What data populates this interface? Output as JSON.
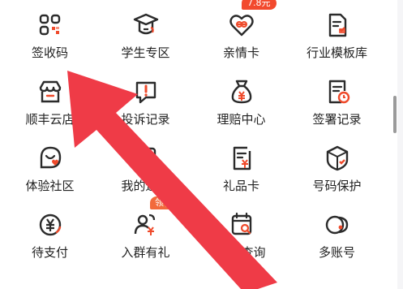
{
  "menu": {
    "items": [
      {
        "label": "签收码",
        "icon": "qr-grid-icon"
      },
      {
        "label": "学生专区",
        "icon": "graduation-cap-icon"
      },
      {
        "label": "亲情卡",
        "icon": "heart-link-icon",
        "badge": "7.8元"
      },
      {
        "label": "行业模板库",
        "icon": "document-template-icon"
      },
      {
        "label": "顺丰云店",
        "icon": "store-icon"
      },
      {
        "label": "投诉记录",
        "icon": "complaint-bubble-icon"
      },
      {
        "label": "理赔中心",
        "icon": "money-bag-icon"
      },
      {
        "label": "签署记录",
        "icon": "signature-clock-icon"
      },
      {
        "label": "体验社区",
        "icon": "community-heart-icon"
      },
      {
        "label": "我的返款",
        "icon": "refund-doc-icon"
      },
      {
        "label": "礼品卡",
        "icon": "gift-card-icon"
      },
      {
        "label": "号码保护",
        "icon": "phone-shield-icon"
      },
      {
        "label": "待支付",
        "icon": "yuan-circle-icon"
      },
      {
        "label": "入群有礼",
        "icon": "group-gift-icon",
        "badge": "领福"
      },
      {
        "label": "票发查询",
        "icon": "invoice-search-icon"
      },
      {
        "label": "多账号",
        "icon": "multi-account-icon"
      }
    ]
  },
  "colors": {
    "icon": "#2b2b2b",
    "accent": "#ef4a2b",
    "arrow": "#ef3b47"
  }
}
